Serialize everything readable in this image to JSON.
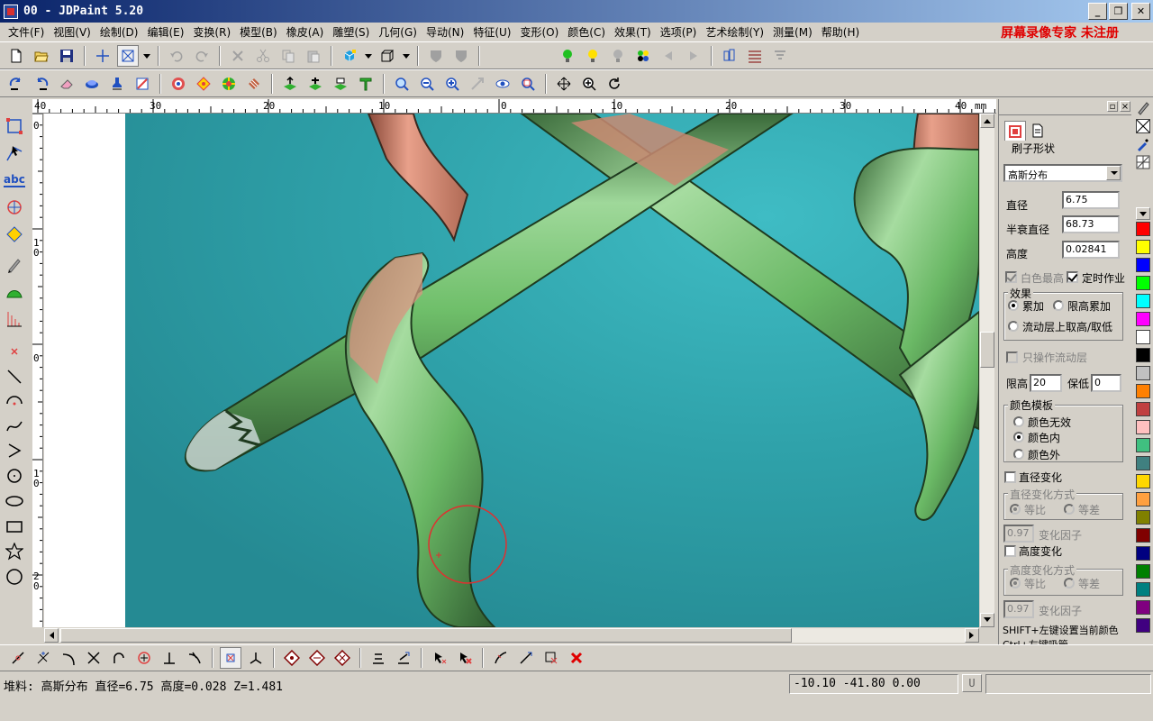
{
  "window": {
    "title": "00 - JDPaint 5.20",
    "min_icon": "minimize-icon",
    "max_icon": "maximize-icon",
    "close_icon": "close-icon"
  },
  "menu": {
    "items": [
      "文件(F)",
      "视图(V)",
      "绘制(D)",
      "编辑(E)",
      "变换(R)",
      "模型(B)",
      "橡皮(A)",
      "雕塑(S)",
      "几何(G)",
      "导动(N)",
      "特征(U)",
      "变形(O)",
      "颜色(C)",
      "效果(T)",
      "选项(P)",
      "艺术绘制(Y)",
      "测量(M)",
      "帮助(H)"
    ],
    "watermark": "屏幕录像专家 未注册"
  },
  "ruler": {
    "unit": "mm",
    "top_labels": [
      "40",
      "30",
      "20",
      "10",
      "0",
      "10",
      "20",
      "30",
      "40"
    ],
    "left_labels": [
      "0",
      "1 0",
      "0",
      "1 0",
      "2 0"
    ]
  },
  "panel": {
    "tabs": [
      "brush-tab-icon",
      "document-tab-icon"
    ],
    "brush_shape_label": "刷子形状",
    "brush_shape_value": "高斯分布",
    "diameter_label": "直径",
    "diameter_value": "6.75",
    "half_decay_label": "半衰直径",
    "half_decay_value": "68.73",
    "height_label": "高度",
    "height_value": "0.02841",
    "white_highest_label": "白色最高",
    "timed_op_label": "定时作业",
    "effect_group_label": "效果",
    "effect_accumulate": "累加",
    "effect_limit_accumulate": "限高累加",
    "effect_flow_layer": "流动层上取高/取低",
    "only_flow_layer_label": "只操作流动层",
    "limit_high_label": "限高",
    "limit_high_value": "20",
    "keep_low_label": "保低",
    "keep_low_value": "0",
    "color_template_label": "颜色模板",
    "color_invalid": "颜色无效",
    "color_inside": "颜色内",
    "color_outside": "颜色外",
    "diameter_change_label": "直径变化",
    "diameter_change_mode_label": "直径变化方式",
    "ratio_label": "等比",
    "diff_label": "等差",
    "factor_value": "0.97",
    "factor_label": "变化因子",
    "height_change_label": "高度变化",
    "height_change_mode_label": "高度变化方式",
    "hint_line1": "SHIFT+左键设置当前颜色",
    "hint_line2": "Ctrl+左键吸管"
  },
  "status": {
    "left": "堆料: 高斯分布  直径=6.75  高度=0.028  Z=1.481",
    "coords": "-10.10 -41.80 0.00",
    "u": "U"
  },
  "palette": [
    "#ffffff",
    "#d4d0c8",
    "#ff0000",
    "#ffff00",
    "#0000ff",
    "#00ff00",
    "#00ffff",
    "#ff00ff",
    "#ffffff",
    "#000000",
    "#c0c0c0",
    "#ff8000",
    "#c04040",
    "#ffc0c0",
    "#40c080",
    "#408080",
    "#ffd700",
    "#ffa040",
    "#808000",
    "#800000",
    "#000080",
    "#008000",
    "#008080",
    "#800080",
    "#400080"
  ]
}
